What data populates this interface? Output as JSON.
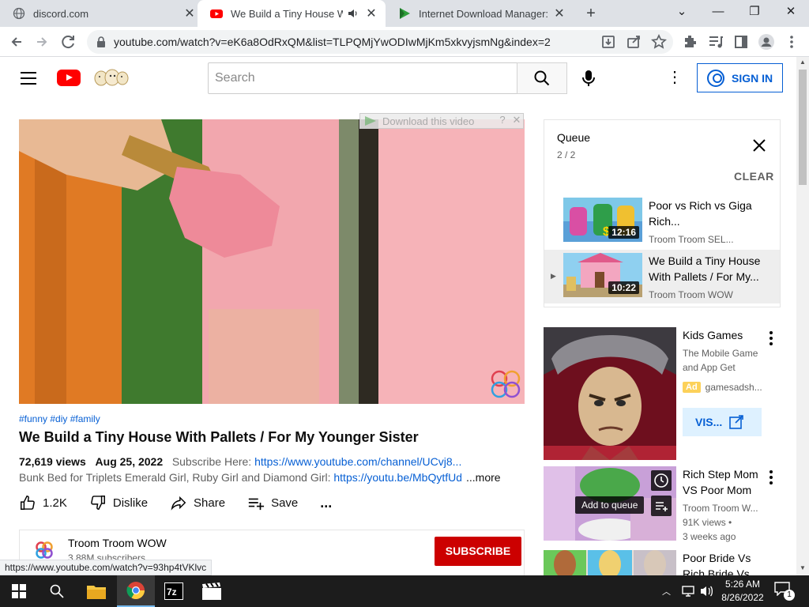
{
  "browser": {
    "tabs": [
      {
        "title": "discord.com",
        "close": "✕"
      },
      {
        "title": "We Build a Tiny House With",
        "close": "✕"
      },
      {
        "title": "Internet Download Manager: I ca",
        "close": "✕"
      }
    ],
    "new_tab": "+",
    "window": {
      "dropdown": "⌄",
      "minimize": "—",
      "restore": "❐",
      "close": "✕"
    },
    "url": "youtube.com/watch?v=eK6a8OdRxQM&list=TLPQMjYwODIwMjKm5xkvyjsmNg&index=2"
  },
  "youtube": {
    "search_placeholder": "Search",
    "sign_in": "SIGN IN",
    "download_bar": "Download this video",
    "download_help": "?",
    "download_close": "✕",
    "video": {
      "tags": "#funny #diy #family",
      "title": "We Build a Tiny House With Pallets / For My Younger Sister",
      "views": "72,619 views",
      "date": "Aug 25, 2022",
      "subscribe_here": "Subscribe Here:",
      "subscribe_link": "https://www.youtube.com/channel/UCvj8...",
      "desc_text": "Bunk Bed for Triplets Emerald Girl, Ruby Girl and Diamond Girl:",
      "desc_link": "https://youtu.be/MbQytfUd-",
      "more": "...more"
    },
    "actions": {
      "likes": "1.2K",
      "dislike": "Dislike",
      "share": "Share",
      "save": "Save",
      "more": "..."
    },
    "channel": {
      "name": "Troom Troom WOW",
      "subscribers": "3.88M subscribers",
      "subscribe": "SUBSCRIBE"
    },
    "status_link": "https://www.youtube.com/watch?v=93hp4tVKlvc",
    "queue": {
      "title": "Queue",
      "count": "2 / 2",
      "clear": "CLEAR",
      "items": [
        {
          "title": "Poor vs Rich vs Giga Rich...",
          "channel": "Troom Troom SEL...",
          "duration": "12:16"
        },
        {
          "title": "We Build a Tiny House With Pallets / For My...",
          "channel": "Troom Troom WOW",
          "duration": "10:22",
          "marker": "▶"
        }
      ]
    },
    "ad": {
      "title": "Kids Games",
      "subtitle": "The Mobile Game and App Get",
      "badge": "Ad",
      "advertiser": "gamesadsh...",
      "button": "VIS..."
    },
    "recommendations": [
      {
        "title": "Rich Step Mom VS Poor Mom",
        "channel": "Troom Troom W...",
        "views": "91K views •",
        "age": "3 weeks ago",
        "hover": "Add to queue"
      },
      {
        "title": "Poor Bride Vs Rich Bride Vs",
        "channel": "",
        "views": "",
        "age": ""
      }
    ]
  },
  "taskbar": {
    "time": "5:26 AM",
    "date": "8/26/2022",
    "notifications": "1"
  }
}
